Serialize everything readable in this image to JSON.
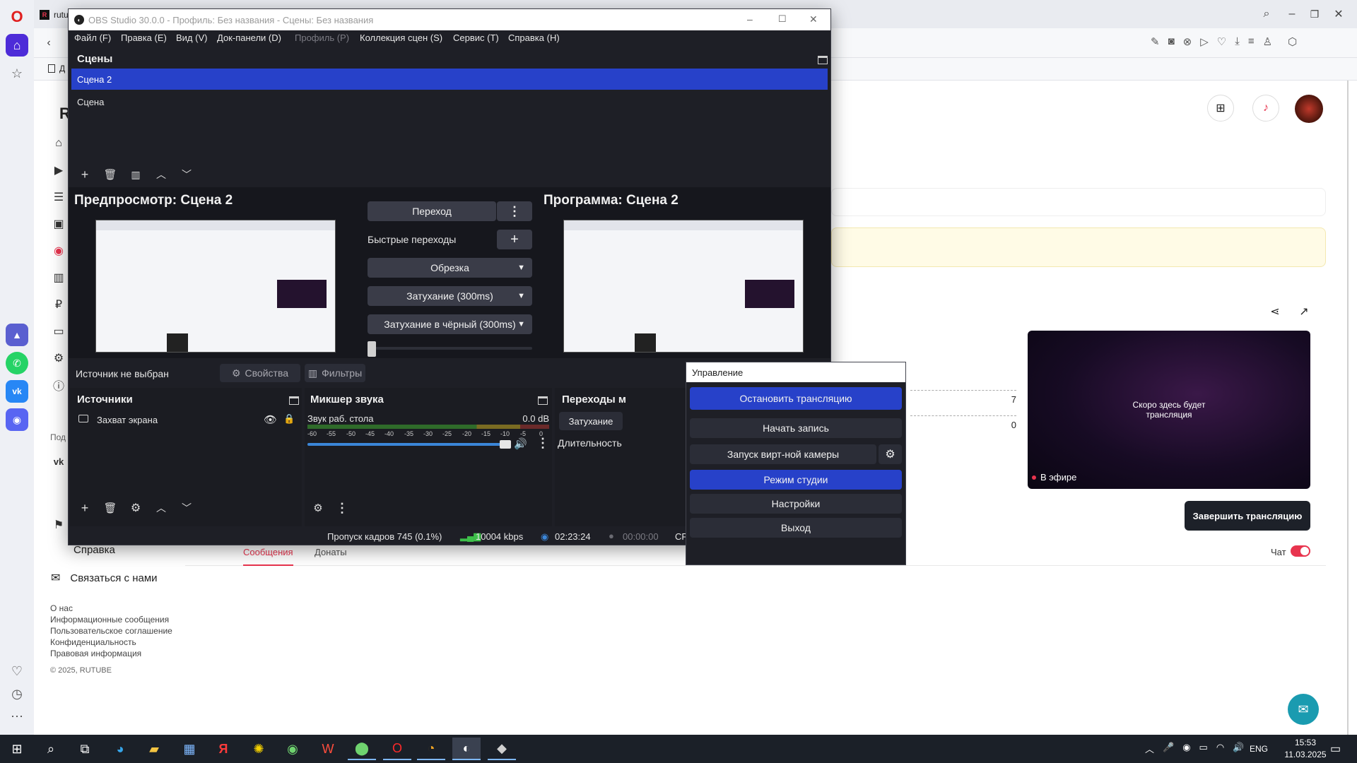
{
  "browser": {
    "tab_label": "rutu",
    "bookmark_label": "Д"
  },
  "rutube": {
    "partial_header_letter": "R",
    "sidebar_partial_label": "Под",
    "help": "Справка",
    "contact": "Связаться с нами",
    "footer_links": [
      "О нас",
      "Информационные сообщения",
      "Пользовательское соглашение",
      "Конфиденциальность",
      "Правовая информация"
    ],
    "copyright": "© 2025, RUTUBE",
    "stat_1": "7",
    "stat_2": "0",
    "stream_preview_text": "Скоро здесь будет трансляция",
    "live_badge": "В эфире",
    "end_stream_button": "Завершить трансляцию",
    "tabs": [
      "Сообщения",
      "Донаты"
    ],
    "chat_label": "Чат",
    "chat_enabled": true,
    "accent_color": "#e8344e"
  },
  "obs": {
    "title": "OBS Studio 30.0.0 - Профиль: Без названия - Сцены: Без названия",
    "menu": [
      "Файл (F)",
      "Правка (E)",
      "Вид (V)",
      "Док-панели (D)",
      "Профиль (P)",
      "Коллекция сцен (S)",
      "Сервис (T)",
      "Справка (H)"
    ],
    "scenes_title": "Сцены",
    "scenes": [
      "Сцена 2",
      "Сцена"
    ],
    "selected_scene": "Сцена 2",
    "preview_title": "Предпросмотр: Сцена 2",
    "program_title": "Программа: Сцена 2",
    "transition_button": "Переход",
    "quick_transitions_label": "Быстрые переходы",
    "quick_transitions": [
      "Обрезка",
      "Затухание (300ms)",
      "Затухание в чёрный (300ms)"
    ],
    "t_bar_value": 0,
    "source_status": "Источник не выбран",
    "properties_button": "Свойства",
    "filters_button": "Фильтры",
    "sources_title": "Источники",
    "sources": [
      {
        "name": "Захват экрана"
      }
    ],
    "mixer_title": "Микшер звука",
    "mixer_channel": "Звук раб. стола",
    "mixer_level": "0.0 dB",
    "mixer_scale": [
      "-60",
      "-55",
      "-50",
      "-45",
      "-40",
      "-35",
      "-30",
      "-25",
      "-20",
      "-15",
      "-10",
      "-5",
      "0"
    ],
    "mixer_volume": 1.0,
    "transitions_title": "Переходы м",
    "transition_type": "Затухание",
    "duration_label": "Длительность",
    "status_dropped": "Пропуск кадров 745 (0.1%)",
    "status_bitrate": "10004 kbps",
    "status_live_time": "02:23:24",
    "status_rec_time": "00:00:00",
    "status_cpu": "CP",
    "accent_color": "#2741c9"
  },
  "control": {
    "title": "Управление",
    "buttons": [
      "Остановить трансляцию",
      "Начать запись",
      "Запуск вирт-ной камеры",
      "Режим студии",
      "Настройки",
      "Выход"
    ]
  },
  "taskbar": {
    "lang": "ENG",
    "time": "15:53",
    "date": "11.03.2025"
  }
}
